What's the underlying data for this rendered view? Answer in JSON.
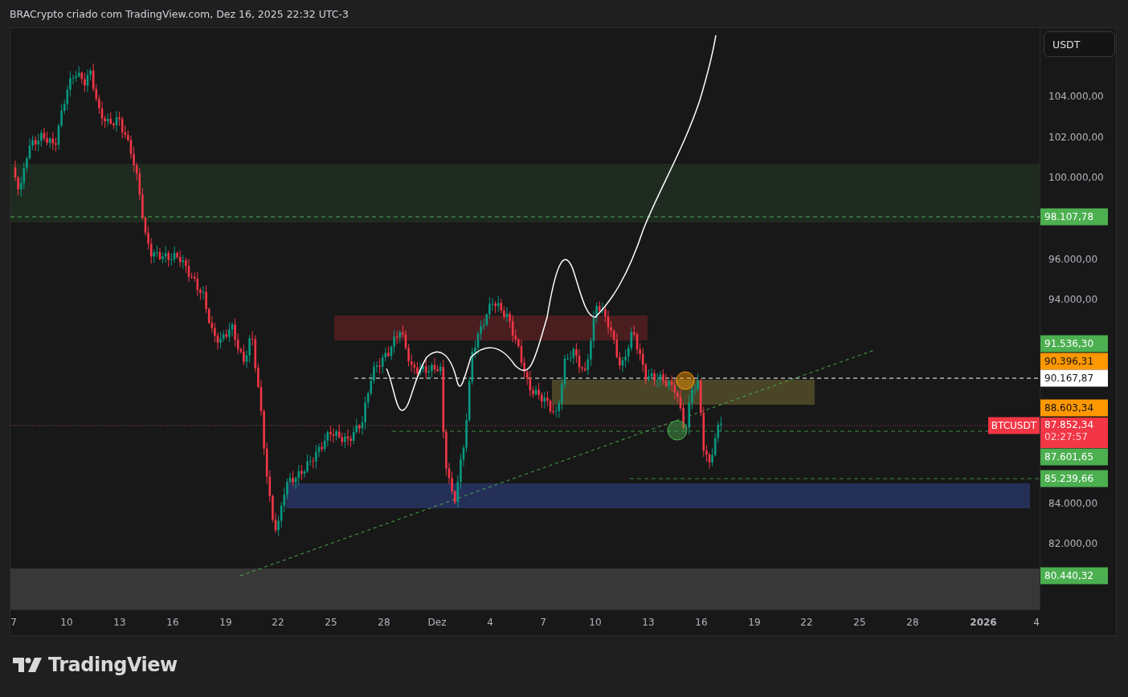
{
  "header": {
    "title": "BRACrypto criado com TradingView.com, Dez 16, 2025 22:32 UTC-3"
  },
  "currency_button": {
    "label": "USDT"
  },
  "price_axis": {
    "ticks": [
      {
        "label": "104.000,00"
      },
      {
        "label": "102.000,00"
      },
      {
        "label": "100.000,00"
      },
      {
        "label": "96.000,00"
      },
      {
        "label": "94.000,00"
      },
      {
        "label": "84.000,00"
      },
      {
        "label": "82.000,00"
      }
    ],
    "tags": [
      {
        "text": "98.107,78",
        "color": "#4caf50"
      },
      {
        "text": "91.536,30",
        "color": "#4caf50"
      },
      {
        "text": "90.396,31",
        "color": "#ff9800"
      },
      {
        "text": "90.167,87",
        "color": "#ffffff"
      },
      {
        "text": "88.603,34",
        "color": "#ff9800"
      },
      {
        "text": "87.601,65",
        "color": "#4caf50"
      },
      {
        "text": "85.239,66",
        "color": "#4caf50"
      },
      {
        "text": "80.440,32",
        "color": "#4caf50"
      }
    ],
    "current_price": {
      "symbol": "BTCUSDT",
      "price": "87.852,34",
      "countdown": "02:27:57",
      "color": "#f23645"
    }
  },
  "time_axis": {
    "ticks": [
      {
        "label": "7",
        "kind": "day"
      },
      {
        "label": "10",
        "kind": "day"
      },
      {
        "label": "13",
        "kind": "day"
      },
      {
        "label": "16",
        "kind": "day"
      },
      {
        "label": "19",
        "kind": "day"
      },
      {
        "label": "22",
        "kind": "day"
      },
      {
        "label": "25",
        "kind": "day"
      },
      {
        "label": "28",
        "kind": "day"
      },
      {
        "label": "Dez",
        "kind": "day"
      },
      {
        "label": "4",
        "kind": "day"
      },
      {
        "label": "7",
        "kind": "day"
      },
      {
        "label": "10",
        "kind": "day"
      },
      {
        "label": "13",
        "kind": "day"
      },
      {
        "label": "16",
        "kind": "day"
      },
      {
        "label": "19",
        "kind": "day"
      },
      {
        "label": "22",
        "kind": "day"
      },
      {
        "label": "25",
        "kind": "day"
      },
      {
        "label": "28",
        "kind": "day"
      },
      {
        "label": "2026",
        "kind": "year"
      },
      {
        "label": "4",
        "kind": "day"
      }
    ]
  },
  "footer": {
    "brand": "TradingView"
  }
}
